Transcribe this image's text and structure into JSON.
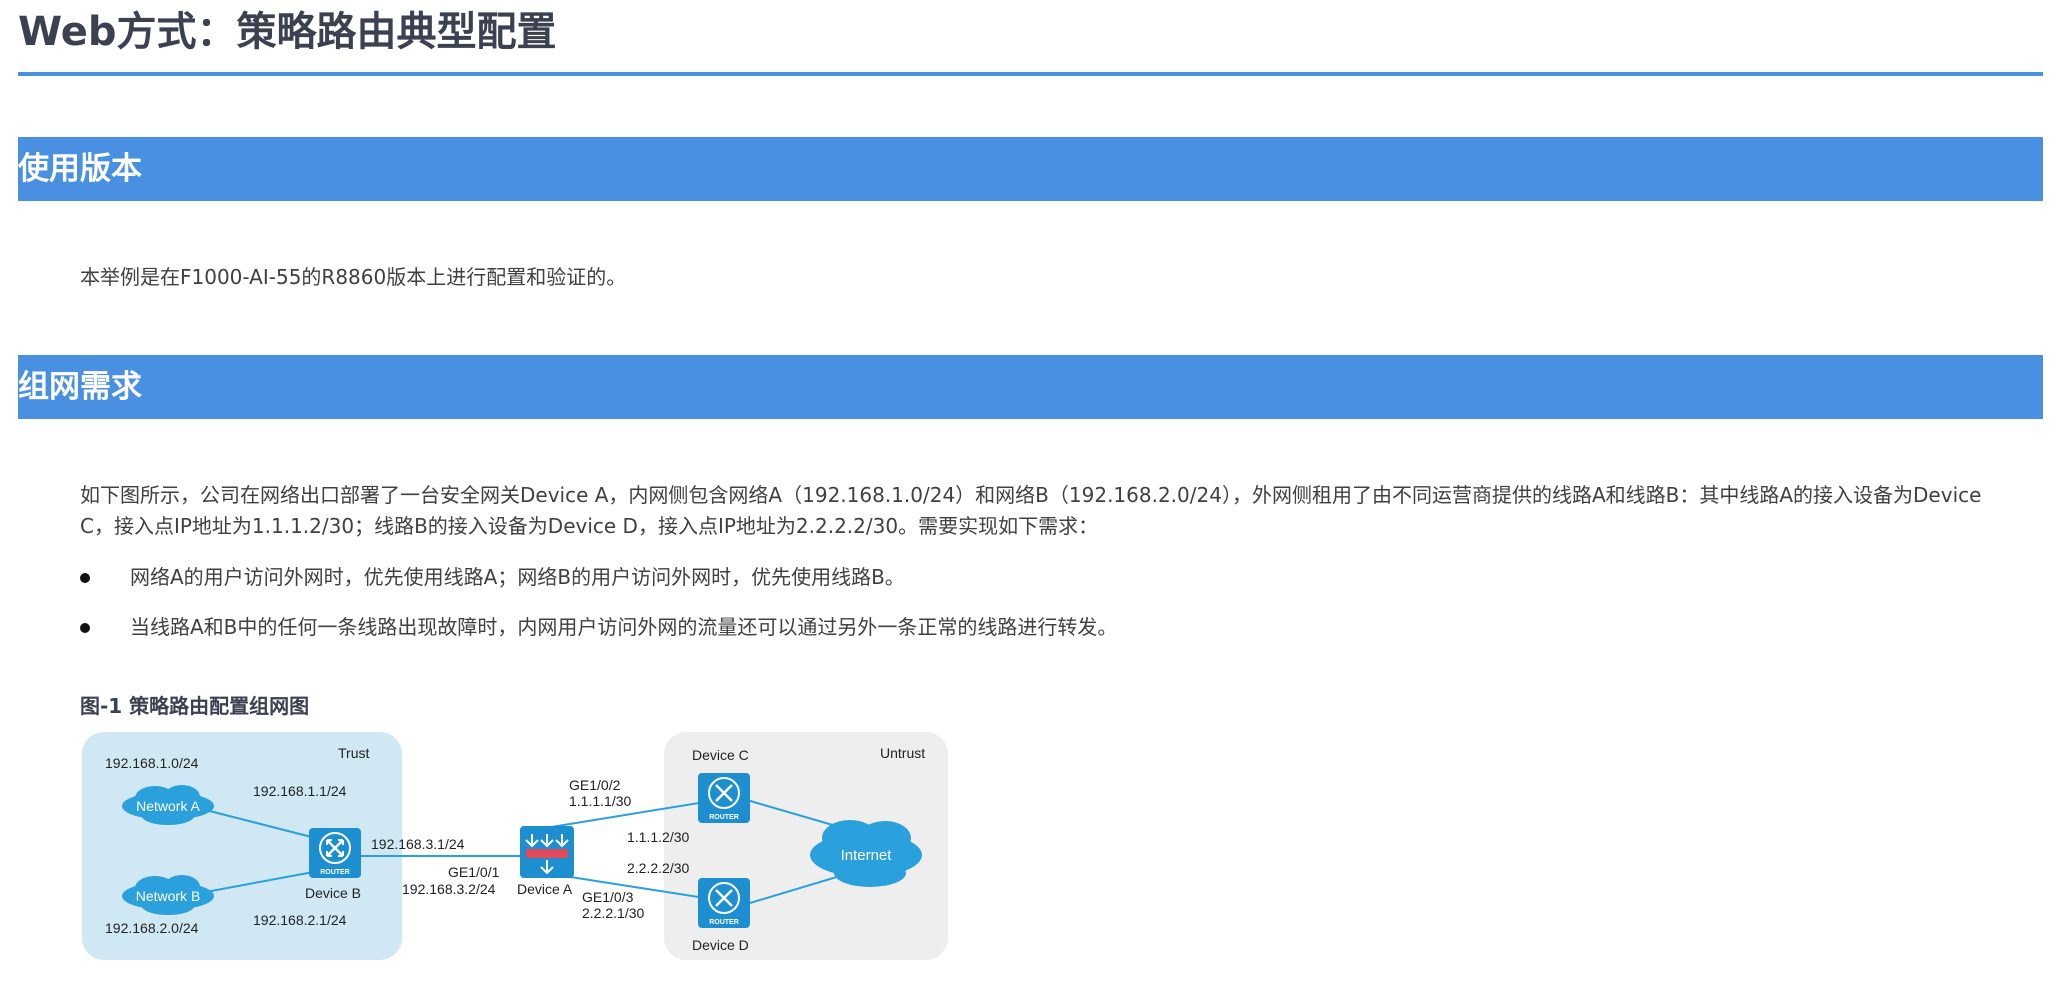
{
  "page": {
    "title": "Web方式：策略路由典型配置"
  },
  "sections": {
    "version": {
      "heading": "使用版本",
      "text": "本举例是在F1000-AI-55的R8860版本上进行配置和验证的。"
    },
    "requirements": {
      "heading": "组网需求",
      "intro_line1": "如下图所示，公司在网络出口部署了一台安全网关Device A，内网侧包含网络A（192.168.1.0/24）和网络B（192.168.2.0/24），外网侧租用了由不同运营商提供的线路A和线路B：其中线路A的接入设备为Device",
      "intro_line2": "C，接入点IP地址为1.1.1.2/30；线路B的接入设备为Device D，接入点IP地址为2.2.2.2/30。需要实现如下需求：",
      "bullets": [
        "网络A的用户访问外网时，优先使用线路A；网络B的用户访问外网时，优先使用线路B。",
        "当线路A和B中的任何一条线路出现故障时，内网用户访问外网的流量还可以通过另外一条正常的线路进行转发。"
      ]
    }
  },
  "figure": {
    "caption": "图-1 策略路由配置组网图",
    "labels": {
      "trust": "Trust",
      "untrust": "Untrust",
      "net_a_subnet": "192.168.1.0/24",
      "net_b_subnet": "192.168.2.0/24",
      "network_a": "Network A",
      "network_b": "Network B",
      "b_if_a": "192.168.1.1/24",
      "b_if_b": "192.168.2.1/24",
      "b_uplink": "192.168.3.1/24",
      "device_b": "Device B",
      "a_ge1": "GE1/0/1",
      "a_ge1_ip": "192.168.3.2/24",
      "device_a": "Device A",
      "a_ge2": "GE1/0/2",
      "a_ge2_ip": "1.1.1.1/30",
      "a_ge3": "GE1/0/3",
      "a_ge3_ip": "2.2.2.1/30",
      "c_ip": "1.1.1.2/30",
      "d_ip": "2.2.2.2/30",
      "device_c": "Device C",
      "device_d": "Device D",
      "internet": "Internet",
      "router_tag": "ROUTER"
    },
    "colors": {
      "accent": "#4a90e2",
      "trust_zone": "#cfe8f3",
      "untrust_zone": "#eeeeee",
      "cloud": "#2aa0dc",
      "router": "#1d8fd0",
      "link": "#2aa0dc",
      "firewall_red": "#e24a5a"
    }
  }
}
